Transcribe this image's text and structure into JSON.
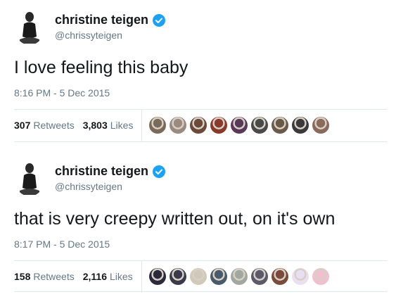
{
  "tweets": [
    {
      "author": {
        "name": "christine teigen",
        "handle": "@chrissyteigen",
        "verified": true
      },
      "text": "I love feeling this baby",
      "timestamp": "8:16 PM - 5 Dec 2015",
      "retweets": {
        "count": "307",
        "label": "Retweets"
      },
      "likes": {
        "count": "3,803",
        "label": "Likes"
      },
      "liker_colors": [
        "#7a6a5a",
        "#9a8a80",
        "#6b4a3a",
        "#8a3a2a",
        "#5a3a5a",
        "#4a4a4a",
        "#6a5a4a",
        "#3a3a3a",
        "#8a6a5a"
      ]
    },
    {
      "author": {
        "name": "christine teigen",
        "handle": "@chrissyteigen",
        "verified": true
      },
      "text": "that is very creepy written out, on it's own",
      "timestamp": "8:17 PM - 5 Dec 2015",
      "retweets": {
        "count": "158",
        "label": "Retweets"
      },
      "likes": {
        "count": "2,116",
        "label": "Likes"
      },
      "liker_colors": [
        "#2a2a3a",
        "#3a3a4a",
        "#d0c8b8",
        "#4a5a6a",
        "#a0a8a0",
        "#5a5a6a",
        "#7a4a3a",
        "#e8e0f0",
        "#f0c0d0"
      ]
    }
  ],
  "colors": {
    "verified": "#1da1f2",
    "secondary_text": "#657786",
    "divider": "#e1e8ed"
  }
}
